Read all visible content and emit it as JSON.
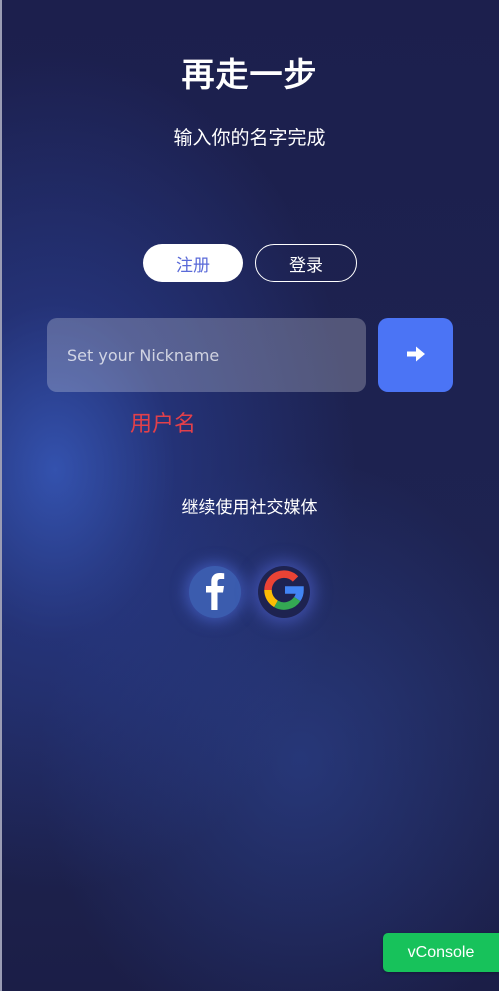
{
  "header": {
    "title": "再走一步",
    "subtitle": "输入你的名字完成"
  },
  "tabs": [
    {
      "label": "注册",
      "active": true
    },
    {
      "label": "登录",
      "active": false
    }
  ],
  "nickname": {
    "placeholder": "Set your Nickname",
    "value": ""
  },
  "submit": {
    "icon": "arrow-right-icon"
  },
  "username_label": "用户名",
  "social": {
    "caption": "继续使用社交媒体",
    "providers": [
      {
        "name": "facebook",
        "icon": "facebook-icon"
      },
      {
        "name": "google",
        "icon": "google-icon"
      }
    ]
  },
  "vconsole": {
    "label": "vConsole"
  },
  "colors": {
    "background": "#1d2150",
    "accent": "#4b74f5",
    "tab_active_text": "#5a6ad8",
    "username_label": "#e2404a",
    "vconsole": "#17c25b"
  }
}
